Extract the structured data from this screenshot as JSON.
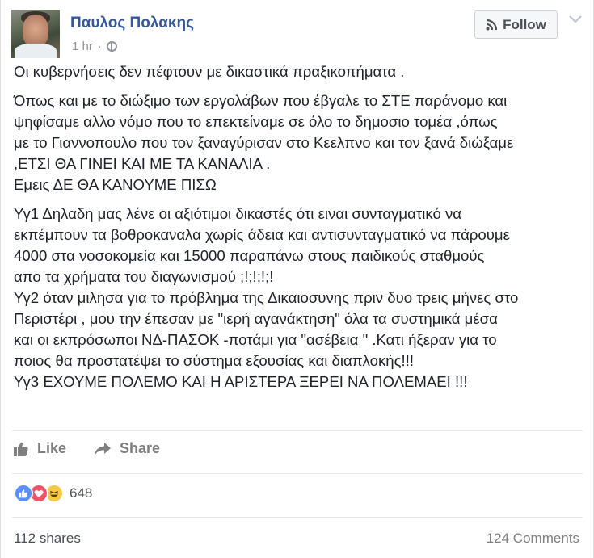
{
  "post": {
    "author": "Παυλος Πολακης",
    "time": "1 hr",
    "follow_label": "Follow",
    "paragraphs": [
      [
        "Οι κυβερνήσεις δεν πέφτουν με δικαστικά πραξικοπήματα ."
      ],
      [
        "Όπως και με το διώξιμο των εργολάβων που έβγαλε το ΣΤΕ παράνομο και",
        "ψηφίσαμε αλλο νόμο που το επεκτείναμε σε όλο το δημοσιο τομέα ,όπως",
        "με το Γιαννοπουλο που τον ξαναγύρισαν στο Κεελπνο και τον ξανά διώξαμε",
        ",ΕΤΣΙ ΘΑ ΓΙΝΕΙ ΚΑΙ ΜΕ ΤΑ ΚΑΝΑΛΙΑ .",
        "Εμεις ΔΕ ΘΑ ΚΑΝΟΥΜΕ ΠΙΣΩ"
      ],
      [
        "Υγ1 Δηλαδη μας λένε οι αξιότιμοι δικαστές ότι ειναι συνταγματικό να",
        "εκπέμπουν τα βοθροκαναλα χωρίς άδεια και αντισυνταγματικό να πάρουμε",
        "4000 στα νοσοκομεία και 15000 παραπάνω στους παιδικούς σταθμούς",
        "απο τα χρήματα του διαγωνισμού ;!;!;!;!",
        "Υγ2 όταν μιλησα για το πρόβλημα της Δικαιοσυνης πριν δυο τρεις μήνες στο",
        "Περιστέρι , μου την έπεσαν με \"ιερή αγανάκτηση\" όλα τα συστημικά μέσα",
        "και οι εκπρόσωποι ΝΔ-ΠΑΣΟΚ -ποτάμι για \"ασέβεια \" .Κατι ήξεραν για το",
        "ποιος θα προστατέψει το σύστημα εξουσίας και διαπλοκής!!!",
        "Υγ3 ΕΧΟΥΜΕ ΠΟΛΕΜΟ ΚΑΙ Η ΑΡΙΣΤΕΡΑ ΞΕΡΕΙ ΝΑ ΠΟΛΕΜΑΕΙ !!!"
      ]
    ],
    "like_label": "Like",
    "share_label": "Share",
    "reaction_count": "648",
    "shares_label": "112 shares",
    "comments_label": "124 Comments",
    "icons": [
      "rss-icon",
      "chevron-down-icon",
      "globe-icon",
      "thumbs-up-icon",
      "share-arrow-icon",
      "like-reaction-icon",
      "love-reaction-icon",
      "haha-reaction-icon"
    ],
    "colors": {
      "author": "#365899",
      "text": "#1d2129",
      "muted": "#90949c",
      "like_reaction": "#5890ff",
      "love_reaction": "#f25268",
      "haha_reaction": "#f7c945"
    }
  }
}
